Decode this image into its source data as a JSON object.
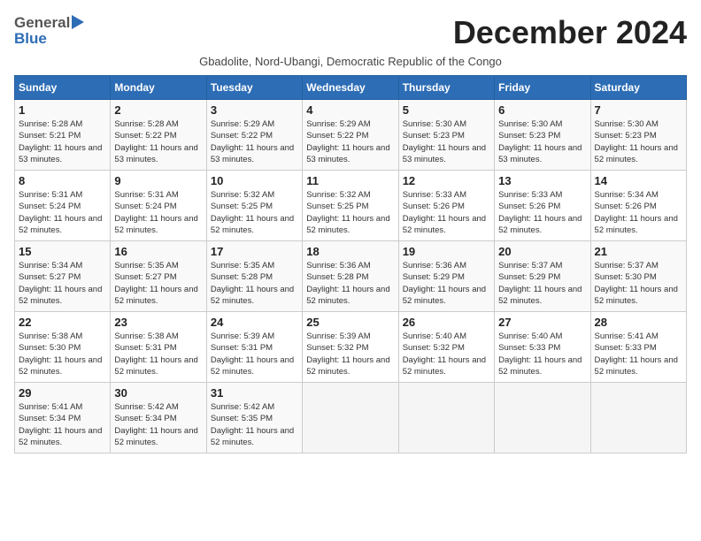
{
  "header": {
    "logo_line1": "General",
    "logo_line2": "Blue",
    "month_title": "December 2024",
    "subtitle": "Gbadolite, Nord-Ubangi, Democratic Republic of the Congo"
  },
  "weekdays": [
    "Sunday",
    "Monday",
    "Tuesday",
    "Wednesday",
    "Thursday",
    "Friday",
    "Saturday"
  ],
  "weeks": [
    [
      {
        "day": "1",
        "sunrise": "5:28 AM",
        "sunset": "5:21 PM",
        "daylight": "11 hours and 53 minutes."
      },
      {
        "day": "2",
        "sunrise": "5:28 AM",
        "sunset": "5:22 PM",
        "daylight": "11 hours and 53 minutes."
      },
      {
        "day": "3",
        "sunrise": "5:29 AM",
        "sunset": "5:22 PM",
        "daylight": "11 hours and 53 minutes."
      },
      {
        "day": "4",
        "sunrise": "5:29 AM",
        "sunset": "5:22 PM",
        "daylight": "11 hours and 53 minutes."
      },
      {
        "day": "5",
        "sunrise": "5:30 AM",
        "sunset": "5:23 PM",
        "daylight": "11 hours and 53 minutes."
      },
      {
        "day": "6",
        "sunrise": "5:30 AM",
        "sunset": "5:23 PM",
        "daylight": "11 hours and 53 minutes."
      },
      {
        "day": "7",
        "sunrise": "5:30 AM",
        "sunset": "5:23 PM",
        "daylight": "11 hours and 52 minutes."
      }
    ],
    [
      {
        "day": "8",
        "sunrise": "5:31 AM",
        "sunset": "5:24 PM",
        "daylight": "11 hours and 52 minutes."
      },
      {
        "day": "9",
        "sunrise": "5:31 AM",
        "sunset": "5:24 PM",
        "daylight": "11 hours and 52 minutes."
      },
      {
        "day": "10",
        "sunrise": "5:32 AM",
        "sunset": "5:25 PM",
        "daylight": "11 hours and 52 minutes."
      },
      {
        "day": "11",
        "sunrise": "5:32 AM",
        "sunset": "5:25 PM",
        "daylight": "11 hours and 52 minutes."
      },
      {
        "day": "12",
        "sunrise": "5:33 AM",
        "sunset": "5:26 PM",
        "daylight": "11 hours and 52 minutes."
      },
      {
        "day": "13",
        "sunrise": "5:33 AM",
        "sunset": "5:26 PM",
        "daylight": "11 hours and 52 minutes."
      },
      {
        "day": "14",
        "sunrise": "5:34 AM",
        "sunset": "5:26 PM",
        "daylight": "11 hours and 52 minutes."
      }
    ],
    [
      {
        "day": "15",
        "sunrise": "5:34 AM",
        "sunset": "5:27 PM",
        "daylight": "11 hours and 52 minutes."
      },
      {
        "day": "16",
        "sunrise": "5:35 AM",
        "sunset": "5:27 PM",
        "daylight": "11 hours and 52 minutes."
      },
      {
        "day": "17",
        "sunrise": "5:35 AM",
        "sunset": "5:28 PM",
        "daylight": "11 hours and 52 minutes."
      },
      {
        "day": "18",
        "sunrise": "5:36 AM",
        "sunset": "5:28 PM",
        "daylight": "11 hours and 52 minutes."
      },
      {
        "day": "19",
        "sunrise": "5:36 AM",
        "sunset": "5:29 PM",
        "daylight": "11 hours and 52 minutes."
      },
      {
        "day": "20",
        "sunrise": "5:37 AM",
        "sunset": "5:29 PM",
        "daylight": "11 hours and 52 minutes."
      },
      {
        "day": "21",
        "sunrise": "5:37 AM",
        "sunset": "5:30 PM",
        "daylight": "11 hours and 52 minutes."
      }
    ],
    [
      {
        "day": "22",
        "sunrise": "5:38 AM",
        "sunset": "5:30 PM",
        "daylight": "11 hours and 52 minutes."
      },
      {
        "day": "23",
        "sunrise": "5:38 AM",
        "sunset": "5:31 PM",
        "daylight": "11 hours and 52 minutes."
      },
      {
        "day": "24",
        "sunrise": "5:39 AM",
        "sunset": "5:31 PM",
        "daylight": "11 hours and 52 minutes."
      },
      {
        "day": "25",
        "sunrise": "5:39 AM",
        "sunset": "5:32 PM",
        "daylight": "11 hours and 52 minutes."
      },
      {
        "day": "26",
        "sunrise": "5:40 AM",
        "sunset": "5:32 PM",
        "daylight": "11 hours and 52 minutes."
      },
      {
        "day": "27",
        "sunrise": "5:40 AM",
        "sunset": "5:33 PM",
        "daylight": "11 hours and 52 minutes."
      },
      {
        "day": "28",
        "sunrise": "5:41 AM",
        "sunset": "5:33 PM",
        "daylight": "11 hours and 52 minutes."
      }
    ],
    [
      {
        "day": "29",
        "sunrise": "5:41 AM",
        "sunset": "5:34 PM",
        "daylight": "11 hours and 52 minutes."
      },
      {
        "day": "30",
        "sunrise": "5:42 AM",
        "sunset": "5:34 PM",
        "daylight": "11 hours and 52 minutes."
      },
      {
        "day": "31",
        "sunrise": "5:42 AM",
        "sunset": "5:35 PM",
        "daylight": "11 hours and 52 minutes."
      },
      null,
      null,
      null,
      null
    ]
  ]
}
